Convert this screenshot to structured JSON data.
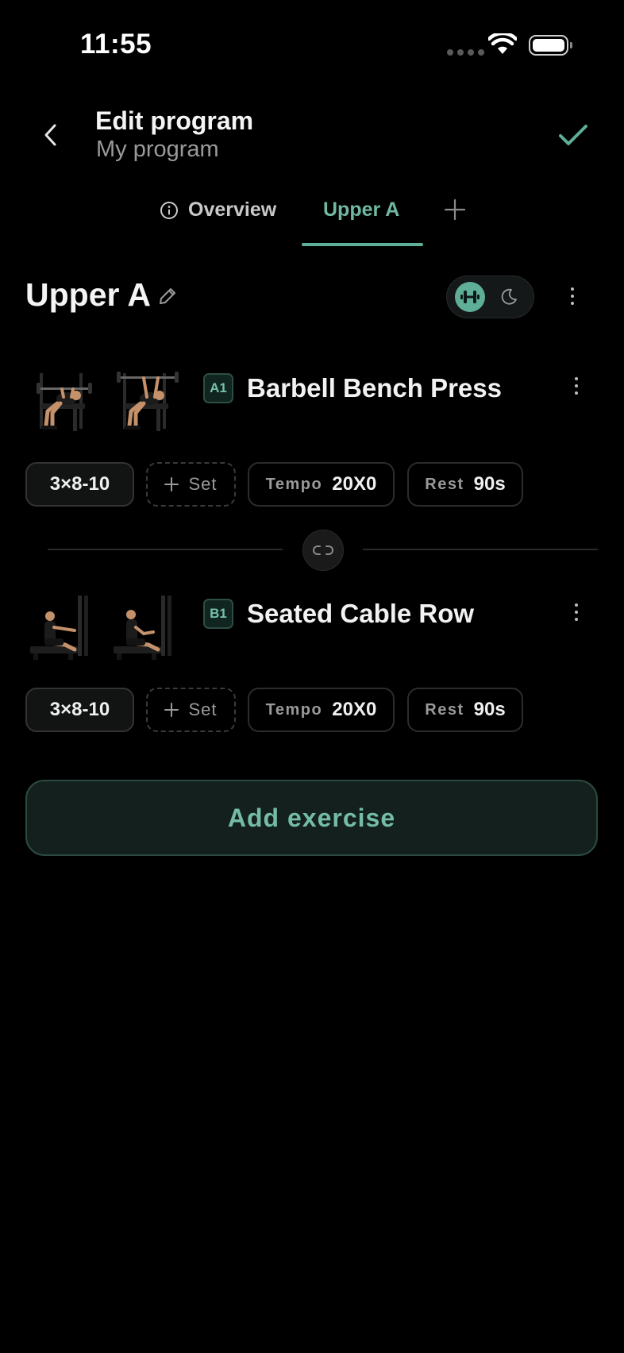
{
  "status_bar": {
    "time": "11:55"
  },
  "header": {
    "title": "Edit program",
    "subtitle": "My program"
  },
  "tabs": [
    {
      "label": "Overview",
      "active": false
    },
    {
      "label": "Upper A",
      "active": true
    }
  ],
  "section": {
    "title": "Upper A"
  },
  "colors": {
    "accent": "#5fae98",
    "background": "#000000"
  },
  "exercises": [
    {
      "badge": "A1",
      "name": "Barbell Bench Press",
      "sets": "3×8-10",
      "add_set": "Set",
      "tempo_label": "Tempo",
      "tempo": "20X0",
      "rest_label": "Rest",
      "rest": "90s"
    },
    {
      "badge": "B1",
      "name": "Seated Cable Row",
      "sets": "3×8-10",
      "add_set": "Set",
      "tempo_label": "Tempo",
      "tempo": "20X0",
      "rest_label": "Rest",
      "rest": "90s"
    }
  ],
  "add_exercise_label": "Add exercise"
}
